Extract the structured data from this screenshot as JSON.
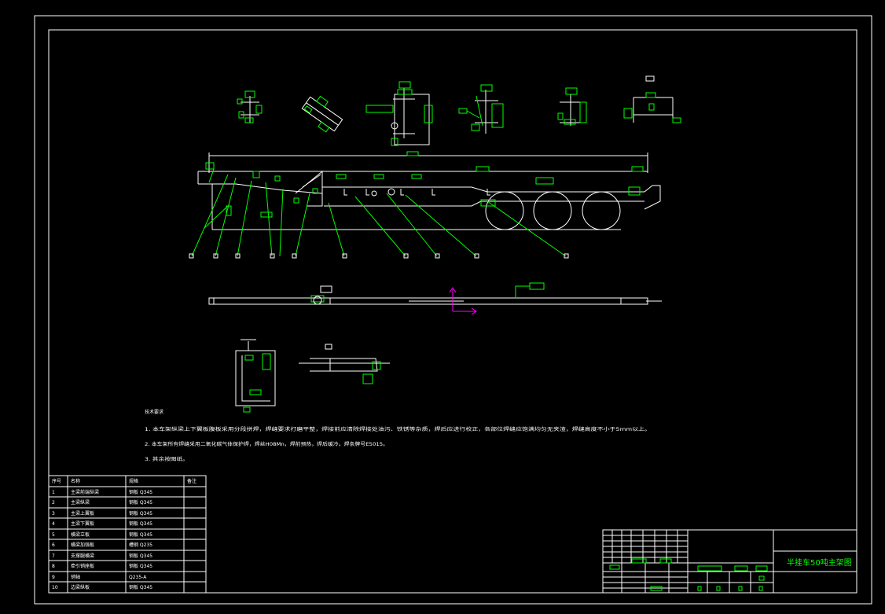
{
  "title_block": {
    "drawing_title": "半挂车50吨主架图"
  },
  "notes": {
    "heading": "技术要求",
    "lines": [
      "1. 本车架纵梁上下翼板腹板采用分段拼焊，焊缝要求打磨平整，焊接前应清除焊接处油污、铁锈等杂质，焊后应进行校正，各部位焊缝应饱满均匀无夹渣，焊缝高度不小于5mm以上。",
      "2. 本车架所有焊缝采用二氧化碳气体保护焊，焊丝H08Mn，焊前预热，焊后缓冷。焊条牌号E5015。",
      "3. 其余按图纸。"
    ]
  },
  "parts_table": {
    "headers": [
      "序号",
      "名称",
      "规格",
      "备注"
    ],
    "rows": [
      [
        "1",
        "主梁前端纵梁",
        "钢板 Q345",
        ""
      ],
      [
        "2",
        "主梁纵梁",
        "钢板 Q345",
        ""
      ],
      [
        "3",
        "主梁上翼板",
        "钢板 Q345",
        ""
      ],
      [
        "4",
        "主梁下翼板",
        "钢板 Q345",
        ""
      ],
      [
        "5",
        "横梁立板",
        "钢板 Q345",
        ""
      ],
      [
        "6",
        "横梁加强板",
        "槽钢 Q235",
        ""
      ],
      [
        "7",
        "支撑腿横梁",
        "钢板 Q345",
        ""
      ],
      [
        "8",
        "牵引销座板",
        "钢板 Q345",
        ""
      ],
      [
        "9",
        "销轴",
        "Q235-A",
        ""
      ],
      [
        "10",
        "边梁纵板",
        "钢板 Q345",
        ""
      ]
    ]
  },
  "colors": {
    "outline": "#ffffff",
    "detail": "#00ff00",
    "ucs": "#ff00ff",
    "background": "#000000"
  }
}
